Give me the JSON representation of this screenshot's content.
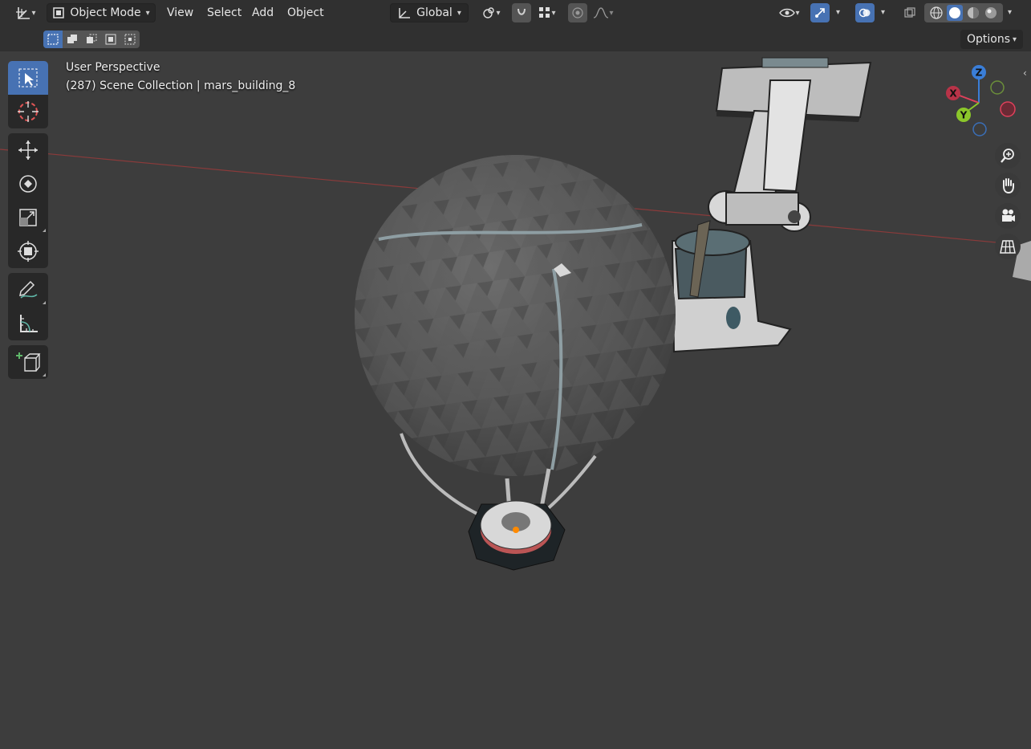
{
  "header": {
    "mode_label": "Object Mode",
    "menus": [
      "View",
      "Select",
      "Add",
      "Object"
    ],
    "orientation_label": "Global",
    "options_label": "Options"
  },
  "viewport": {
    "perspective_label": "User Perspective",
    "collection_label": "(287) Scene Collection | mars_building_8"
  },
  "gizmo": {
    "x_label": "X",
    "y_label": "Y",
    "z_label": "Z"
  },
  "colors": {
    "accent": "#4772b3",
    "header_bg": "#303030",
    "viewport_bg": "#3d3d3d",
    "axis_x": "#e0405b",
    "axis_y": "#8bc72a",
    "axis_z": "#3a7ed8"
  },
  "icons": {
    "editor_type": "axes-icon",
    "tools": [
      "select-box-icon",
      "cursor-icon",
      "move-icon",
      "rotate-icon",
      "scale-icon",
      "transform-icon",
      "annotate-icon",
      "measure-icon",
      "add-cube-icon"
    ],
    "nav": [
      "zoom-icon",
      "pan-hand-icon",
      "camera-icon",
      "grid-icon"
    ]
  }
}
